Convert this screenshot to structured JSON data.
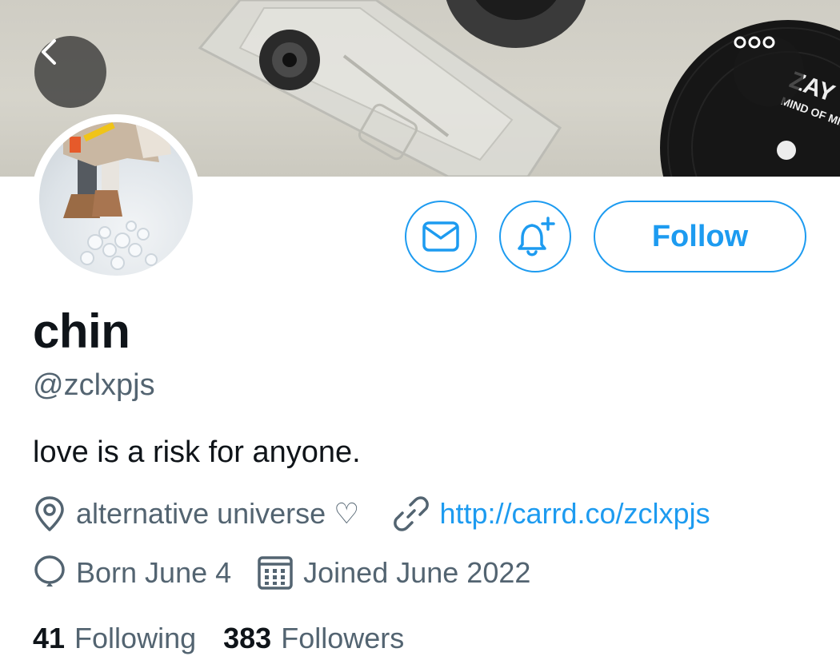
{
  "profile": {
    "display_name": "chin",
    "handle": "@zclxpjs",
    "bio": "love is a risk for anyone.",
    "location": "alternative universe ♡",
    "website": "http://carrd.co/zclxpjs",
    "birthday": "Born June 4",
    "joined": "Joined June 2022"
  },
  "actions": {
    "follow_label": "Follow"
  },
  "stats": {
    "following_count": "41",
    "following_label": "Following",
    "followers_count": "383",
    "followers_label": "Followers"
  },
  "banner": {
    "record_text_1": "ZAY",
    "record_text_2": "MIND OF MINE"
  },
  "icons": {
    "back": "chevron-left-icon",
    "more": "more-icon",
    "message": "envelope-icon",
    "notify": "bell-plus-icon",
    "location": "location-pin-icon",
    "link": "link-icon",
    "birthday": "balloon-icon",
    "joined": "calendar-icon"
  },
  "colors": {
    "accent": "#1d9bf0",
    "text_primary": "#0f1419",
    "text_secondary": "#536471"
  }
}
